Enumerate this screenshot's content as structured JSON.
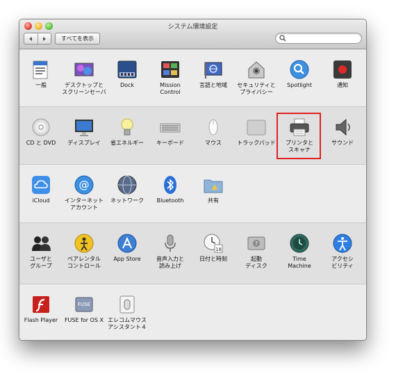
{
  "window": {
    "title": "システム環境設定",
    "show_all_label": "すべてを表示",
    "search_placeholder": "",
    "highlight_color": "#e02020"
  },
  "sections": [
    {
      "items": [
        {
          "label": "一般",
          "icon": "general-icon"
        },
        {
          "label": "デスクトップと\nスクリーンセーバ",
          "icon": "desktop-icon"
        },
        {
          "label": "Dock",
          "icon": "dock-icon"
        },
        {
          "label": "Mission\nControl",
          "icon": "mission-control-icon"
        },
        {
          "label": "言語と地域",
          "icon": "language-icon"
        },
        {
          "label": "セキュリティと\nプライバシー",
          "icon": "security-icon"
        },
        {
          "label": "Spotlight",
          "icon": "spotlight-icon"
        },
        {
          "label": "通知",
          "icon": "notifications-icon"
        }
      ]
    },
    {
      "items": [
        {
          "label": "CD と DVD",
          "icon": "cd-dvd-icon"
        },
        {
          "label": "ディスプレイ",
          "icon": "display-icon"
        },
        {
          "label": "省エネルギー",
          "icon": "energy-saver-icon"
        },
        {
          "label": "キーボード",
          "icon": "keyboard-icon"
        },
        {
          "label": "マウス",
          "icon": "mouse-icon"
        },
        {
          "label": "トラックパッド",
          "icon": "trackpad-icon"
        },
        {
          "label": "プリンタと\nスキャナ",
          "icon": "printer-icon"
        },
        {
          "label": "サウンド",
          "icon": "sound-icon"
        }
      ]
    },
    {
      "items": [
        {
          "label": "iCloud",
          "icon": "icloud-icon"
        },
        {
          "label": "インターネット\nアカウント",
          "icon": "internet-accounts-icon"
        },
        {
          "label": "ネットワーク",
          "icon": "network-icon"
        },
        {
          "label": "Bluetooth",
          "icon": "bluetooth-icon"
        },
        {
          "label": "共有",
          "icon": "sharing-icon"
        }
      ]
    },
    {
      "items": [
        {
          "label": "ユーザと\nグループ",
          "icon": "users-icon"
        },
        {
          "label": "ペアレンタル\nコントロール",
          "icon": "parental-controls-icon"
        },
        {
          "label": "App Store",
          "icon": "app-store-icon"
        },
        {
          "label": "音声入力と\n読み上げ",
          "icon": "dictation-icon"
        },
        {
          "label": "日付と時刻",
          "icon": "date-time-icon"
        },
        {
          "label": "起動\nディスク",
          "icon": "startup-disk-icon"
        },
        {
          "label": "Time\nMachine",
          "icon": "time-machine-icon"
        },
        {
          "label": "アクセシ\nビリティ",
          "icon": "accessibility-icon"
        }
      ]
    },
    {
      "items": [
        {
          "label": "Flash Player",
          "icon": "flash-player-icon"
        },
        {
          "label": "FUSE for OS X",
          "icon": "fuse-icon"
        },
        {
          "label": "エレコムマウス\nアシスタント４",
          "icon": "elecom-mouse-icon"
        }
      ]
    }
  ]
}
